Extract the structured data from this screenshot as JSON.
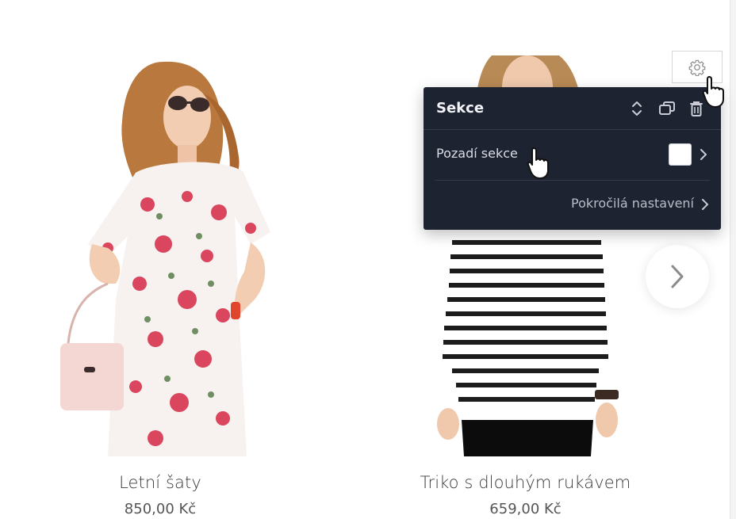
{
  "products": [
    {
      "name": "Letní šaty",
      "price": "850,00 Kč"
    },
    {
      "name": "Triko s dlouhým rukávem",
      "price": "659,00 Kč"
    }
  ],
  "panel": {
    "title": "Sekce",
    "background_label": "Pozadí sekce",
    "advanced_label": "Pokročilá nastavení",
    "background_color": "#ffffff"
  },
  "icons": {
    "gear": "gear-icon",
    "sort": "up-down-arrows-icon",
    "duplicate": "duplicate-icon",
    "delete": "trash-icon",
    "next": "chevron-right-icon",
    "pointer": "hand-pointer-icon"
  },
  "colors": {
    "panel_bg": "#1e2332",
    "page_bg": "#ffffff"
  }
}
